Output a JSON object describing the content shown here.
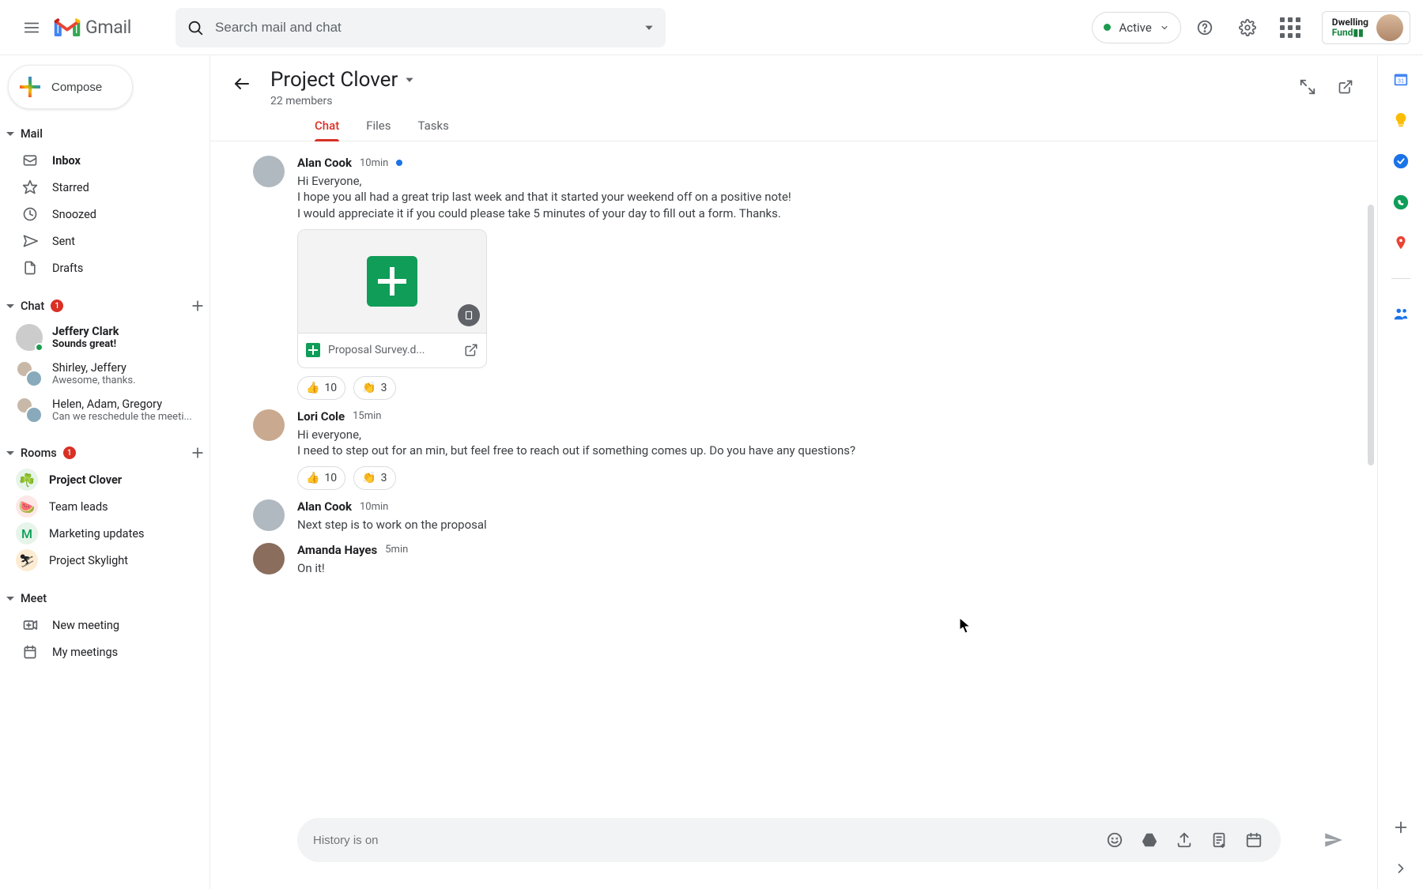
{
  "header": {
    "product_name": "Gmail",
    "search_placeholder": "Search mail and chat",
    "status_label": "Active",
    "org_line1": "Dwelling",
    "org_line2": "Fund"
  },
  "compose_label": "Compose",
  "sections": {
    "mail": {
      "label": "Mail"
    },
    "chat": {
      "label": "Chat",
      "badge": "1"
    },
    "rooms": {
      "label": "Rooms",
      "badge": "1"
    },
    "meet": {
      "label": "Meet"
    }
  },
  "mail_items": [
    {
      "label": "Inbox",
      "bold": true
    },
    {
      "label": "Starred",
      "bold": false
    },
    {
      "label": "Snoozed",
      "bold": false
    },
    {
      "label": "Sent",
      "bold": false
    },
    {
      "label": "Drafts",
      "bold": false
    }
  ],
  "chat_items": [
    {
      "name": "Jeffery Clark",
      "preview": "Sounds great!",
      "unread": true,
      "double": false,
      "presence": true
    },
    {
      "name": "Shirley, Jeffery",
      "preview": "Awesome, thanks.",
      "unread": false,
      "double": true,
      "presence": false
    },
    {
      "name": "Helen, Adam, Gregory",
      "preview": "Can we reschedule the meeti...",
      "unread": false,
      "double": true,
      "presence": false
    }
  ],
  "room_items": [
    {
      "emoji": "☘️",
      "label": "Project Clover",
      "active": true,
      "bg": "#e6f4ea"
    },
    {
      "emoji": "🍉",
      "label": "Team leads",
      "active": false,
      "bg": "#fde7e7"
    },
    {
      "emoji": "M",
      "label": "Marketing updates",
      "active": false,
      "bg": "#e6f4ea",
      "letter": true
    },
    {
      "emoji": "⛷",
      "label": "Project Skylight",
      "active": false,
      "bg": "#fdecd2"
    }
  ],
  "meet_items": [
    {
      "label": "New meeting"
    },
    {
      "label": "My meetings"
    }
  ],
  "room": {
    "title": "Project Clover",
    "members": "22 members",
    "tabs": [
      "Chat",
      "Files",
      "Tasks"
    ],
    "active_tab": 0
  },
  "messages": [
    {
      "author": "Alan Cook",
      "time": "10min",
      "unread": true,
      "lines": [
        "Hi Everyone,",
        "I hope you all had a great trip last week and that it started your weekend off on a positive note!",
        "I would appreciate it if you could please take 5 minutes of your day to fill out a form. Thanks."
      ],
      "attachment": {
        "name": "Proposal Survey.d..."
      },
      "reactions": [
        {
          "emoji": "👍",
          "count": "10"
        },
        {
          "emoji": "👏",
          "count": "3"
        }
      ]
    },
    {
      "author": "Lori Cole",
      "time": "15min",
      "unread": false,
      "lines": [
        "Hi everyone,",
        "I need to step out for an min, but feel free to reach out if something comes up.  Do you have any questions?"
      ],
      "reactions": [
        {
          "emoji": "👍",
          "count": "10"
        },
        {
          "emoji": "👏",
          "count": "3"
        }
      ]
    },
    {
      "author": "Alan Cook",
      "time": "10min",
      "unread": false,
      "lines": [
        "Next step is to work on the proposal"
      ]
    },
    {
      "author": "Amanda Hayes",
      "time": "5min",
      "unread": false,
      "lines": [
        "On it!"
      ]
    }
  ],
  "chat_input_placeholder": "History is on"
}
